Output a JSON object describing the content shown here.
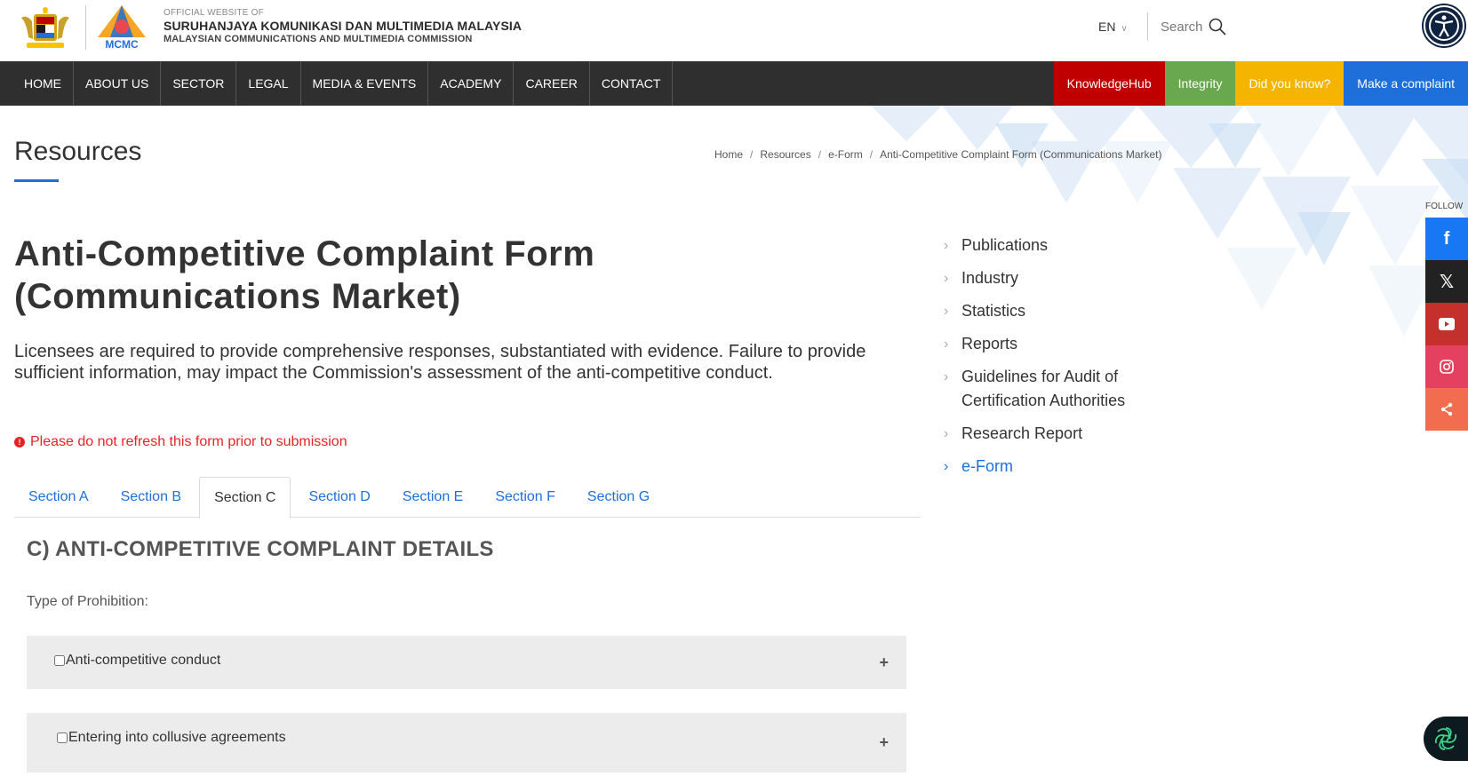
{
  "header": {
    "official_label": "OFFICIAL WEBSITE OF",
    "org_name_ms": "SURUHANJAYA KOMUNIKASI DAN MULTIMEDIA MALAYSIA",
    "org_name_en": "MALAYSIAN COMMUNICATIONS AND MULTIMEDIA COMMISSION",
    "logo_text": "MCMC",
    "language": "EN",
    "search_label": "Search"
  },
  "nav": {
    "items": [
      "HOME",
      "ABOUT US",
      "SECTOR",
      "LEGAL",
      "MEDIA & EVENTS",
      "ACADEMY",
      "CAREER",
      "CONTACT"
    ],
    "buttons": [
      {
        "label": "KnowledgeHub",
        "color": "#c00000"
      },
      {
        "label": "Integrity",
        "color": "#6aa84f"
      },
      {
        "label": "Did you know?",
        "color": "#f5b400"
      },
      {
        "label": "Make a complaint",
        "color": "#1e6fd9"
      }
    ]
  },
  "page": {
    "title": "Resources",
    "breadcrumb": [
      "Home",
      "Resources",
      "e-Form",
      "Anti-Competitive Complaint Form (Communications Market)"
    ]
  },
  "social": {
    "label": "FOLLOW",
    "items": [
      {
        "icon": "facebook-icon",
        "color": "#1877f2"
      },
      {
        "icon": "x-icon",
        "color": "#222222"
      },
      {
        "icon": "youtube-icon",
        "color": "#c4302b"
      },
      {
        "icon": "instagram-icon",
        "color": "#e4405f"
      },
      {
        "icon": "share-icon",
        "color": "#f26c4f"
      }
    ]
  },
  "form": {
    "title": "Anti-Competitive Complaint Form (Communications Market)",
    "intro": "Licensees are required to provide comprehensive responses, substantiated with evidence. Failure to provide sufficient information, may impact the Commission's assessment of the anti-competitive conduct.",
    "warning": "Please do not refresh this form prior to submission",
    "tabs": [
      "Section A",
      "Section B",
      "Section C",
      "Section D",
      "Section E",
      "Section F",
      "Section G"
    ],
    "active_tab": "Section C",
    "section_heading": "C) ANTI-COMPETITIVE COMPLAINT DETAILS",
    "type_label": "Type of Prohibition:",
    "options": [
      {
        "label": "Anti-competitive conduct",
        "checked": false
      },
      {
        "label": "Entering into collusive agreements",
        "checked": false
      }
    ]
  },
  "sidebar": {
    "items": [
      {
        "label": "Publications",
        "active": false
      },
      {
        "label": "Industry",
        "active": false
      },
      {
        "label": "Statistics",
        "active": false
      },
      {
        "label": "Reports",
        "active": false
      },
      {
        "label": "Guidelines for Audit of Certification Authorities",
        "active": false
      },
      {
        "label": "Research Report",
        "active": false
      },
      {
        "label": "e-Form",
        "active": true
      }
    ]
  }
}
